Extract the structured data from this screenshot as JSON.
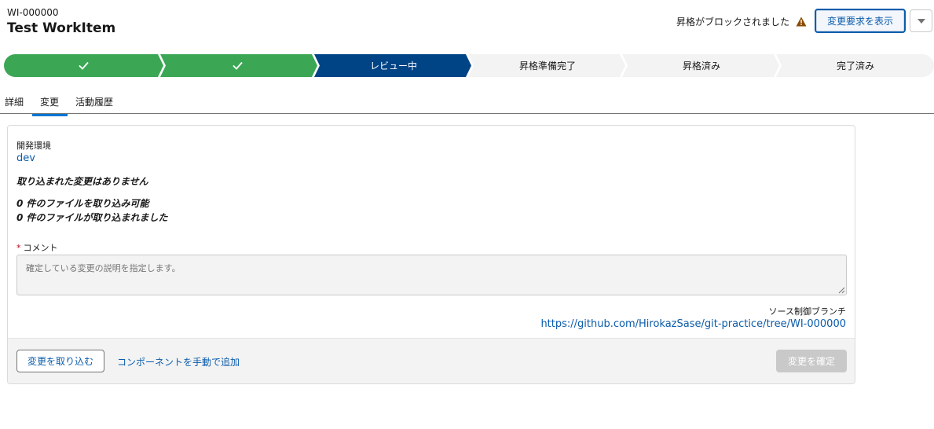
{
  "header": {
    "record_id": "WI-000000",
    "title": "Test WorkItem",
    "blocked_text": "昇格がブロックされました",
    "view_changes_label": "変更要求を表示"
  },
  "path": {
    "stages": [
      {
        "label": "",
        "state": "complete",
        "icon": "checkmark-icon"
      },
      {
        "label": "",
        "state": "complete",
        "icon": "checkmark-icon"
      },
      {
        "label": "レビュー中",
        "state": "current"
      },
      {
        "label": "昇格準備完了",
        "state": "incomplete"
      },
      {
        "label": "昇格済み",
        "state": "incomplete"
      },
      {
        "label": "完了済み",
        "state": "incomplete"
      }
    ]
  },
  "tabs": [
    {
      "label": "詳細",
      "active": false
    },
    {
      "label": "変更",
      "active": true
    },
    {
      "label": "活動履歴",
      "active": false
    }
  ],
  "card": {
    "env_label": "開発環境",
    "env_value": "dev",
    "no_changes": "取り込まれた変更はありません",
    "files_available": "0 件のファイルを取り込み可能",
    "files_imported": "0 件のファイルが取り込まれました",
    "comment_required_mark": "*",
    "comment_label": "コメント",
    "comment_placeholder": "確定している変更の説明を指定します。",
    "branch_label": "ソース制御ブランチ",
    "branch_url": "https://github.com/HirokazSase/git-practice/tree/WI-000000",
    "import_label": "変更を取り込む",
    "add_manual_label": "コンポーネントを手動で追加",
    "confirm_label": "変更を確定"
  },
  "colors": {
    "complete": "#3ba755",
    "current": "#014486",
    "incomplete": "#f3f3f3",
    "link": "#0b5cab",
    "warning": "#8c4b02"
  }
}
